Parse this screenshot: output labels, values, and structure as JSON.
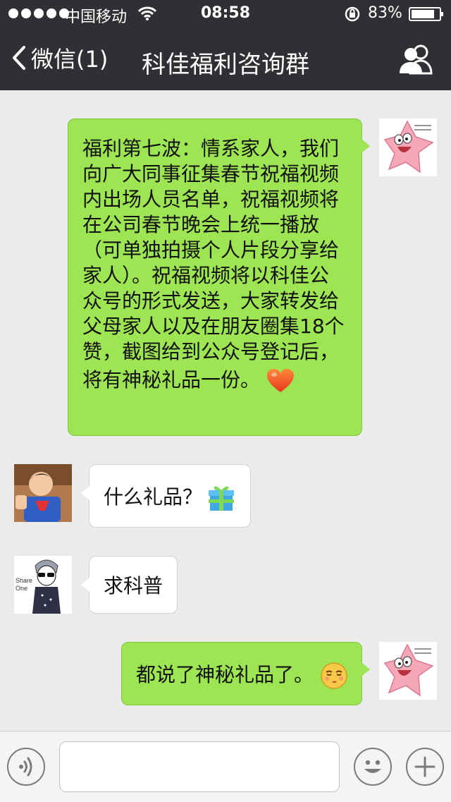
{
  "status_bar": {
    "carrier": "中国移动",
    "time": "08:58",
    "battery": "83%",
    "battery_level": 0.83
  },
  "nav": {
    "back_label": "微信(1)",
    "title": "科佳福利咨询群",
    "contacts_icon": "group-icon"
  },
  "messages": [
    {
      "direction": "outgoing",
      "avatar": "patrick-star-avatar",
      "lines": [
        "福利第七波：情系家人，我们",
        "向广大同事征集春节祝福视频",
        "内出场人员名单，祝福视频将",
        "在公司春节晚会上统一播放",
        "（可单独拍摄个人片段分享给",
        "家人）。祝福视频将以科佳公",
        "众号的形式发送，大家转发给",
        "父母家人以及在朋友圈集18个",
        "赞，截图给到公众号登记后，",
        "将有神秘礼品一份。"
      ],
      "emoji": "heart-emoji"
    },
    {
      "direction": "incoming",
      "avatar": "boy-superman-avatar",
      "text": "什么礼品？",
      "emoji": "gift-emoji"
    },
    {
      "direction": "incoming",
      "avatar": "share-one-cartoon-avatar",
      "avatar_text": "Share One",
      "text": "求科普"
    },
    {
      "direction": "outgoing",
      "avatar": "patrick-star-avatar",
      "text": "都说了神秘礼品了。",
      "emoji": "smirk-emoji"
    }
  ],
  "input_bar": {
    "voice_icon": "voice-icon",
    "input_value": "",
    "emoji_icon": "emoji-icon",
    "add_icon": "plus-icon"
  },
  "colors": {
    "nav_bg": "#2f3033",
    "chat_bg": "#ebebeb",
    "outgoing_bubble": "#9de553",
    "incoming_bubble": "#ffffff"
  }
}
